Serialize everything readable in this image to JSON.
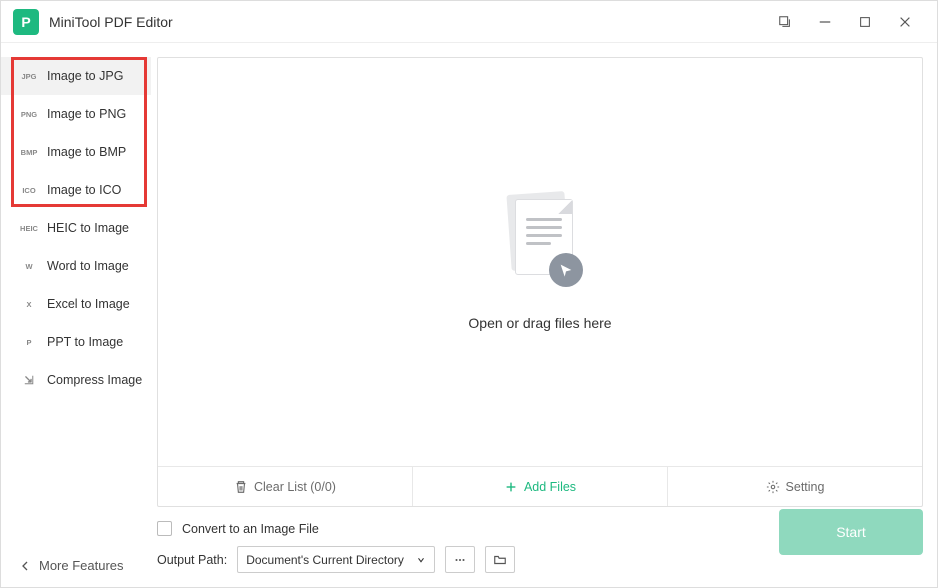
{
  "app": {
    "title": "MiniTool PDF Editor",
    "logo_letter": "P"
  },
  "sidebar": {
    "items": [
      {
        "tag": "JPG",
        "label": "Image to JPG",
        "active": true
      },
      {
        "tag": "PNG",
        "label": "Image to PNG",
        "active": false
      },
      {
        "tag": "BMP",
        "label": "Image to BMP",
        "active": false
      },
      {
        "tag": "ICO",
        "label": "Image to ICO",
        "active": false
      },
      {
        "tag": "HEIC",
        "label": "HEIC to Image",
        "active": false
      },
      {
        "tag": "W",
        "label": "Word to Image",
        "active": false
      },
      {
        "tag": "X",
        "label": "Excel to Image",
        "active": false
      },
      {
        "tag": "P",
        "label": "PPT to Image",
        "active": false
      },
      {
        "tag": "⇲",
        "label": "Compress Image",
        "active": false
      }
    ],
    "more_label": "More Features"
  },
  "main": {
    "drop_text": "Open or drag files here",
    "actions": {
      "clear": "Clear List (0/0)",
      "add": "Add Files",
      "setting": "Setting"
    }
  },
  "bottom": {
    "convert_label": "Convert to an Image File",
    "path_label": "Output Path:",
    "path_selected": "Document's Current Directory",
    "start_label": "Start"
  },
  "colors": {
    "accent": "#1eb980",
    "highlight": "#e53935",
    "start_bg": "#8fd9be"
  }
}
